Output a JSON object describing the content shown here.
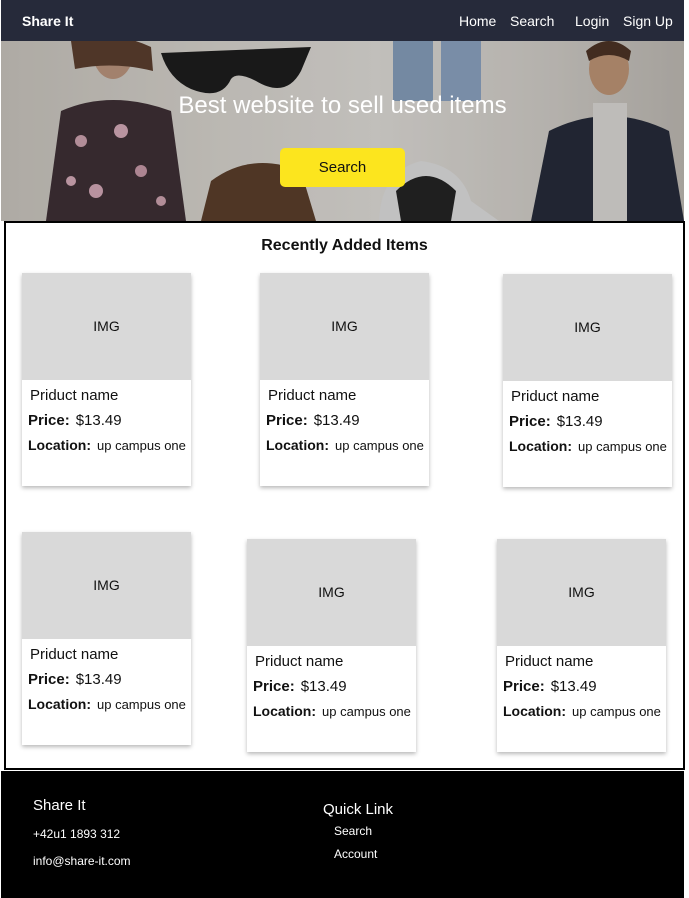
{
  "nav": {
    "brand": "Share It",
    "links": [
      "Home",
      "Search",
      "Login",
      "Sign Up"
    ]
  },
  "hero": {
    "title": "Best website to sell used items",
    "search_label": "Search",
    "button_color": "#fce51e"
  },
  "recent": {
    "title": "Recently Added Items",
    "items": [
      {
        "img": "IMG",
        "name": "Priduct name",
        "price_label": "Price:",
        "price": "$13.49",
        "location_label": "Location:",
        "location": "up campus one"
      },
      {
        "img": "IMG",
        "name": "Priduct name",
        "price_label": "Price:",
        "price": "$13.49",
        "location_label": "Location:",
        "location": "up campus one"
      },
      {
        "img": "IMG",
        "name": "Priduct name",
        "price_label": "Price:",
        "price": "$13.49",
        "location_label": "Location:",
        "location": "up campus one"
      },
      {
        "img": "IMG",
        "name": "Priduct name",
        "price_label": "Price:",
        "price": "$13.49",
        "location_label": "Location:",
        "location": "up campus one"
      },
      {
        "img": "IMG",
        "name": "Priduct name",
        "price_label": "Price:",
        "price": "$13.49",
        "location_label": "Location:",
        "location": "up campus one"
      },
      {
        "img": "IMG",
        "name": "Priduct name",
        "price_label": "Price:",
        "price": "$13.49",
        "location_label": "Location:",
        "location": "up campus one"
      }
    ]
  },
  "footer": {
    "brand": "Share It",
    "phone": "+42u1 1893 312",
    "email": "info@share-it.com",
    "quick_title": "Quick Link",
    "links": [
      "Search",
      "Account"
    ]
  },
  "colors": {
    "navbar": "#262a3a",
    "accent": "#fce51e",
    "footer": "#000000"
  }
}
